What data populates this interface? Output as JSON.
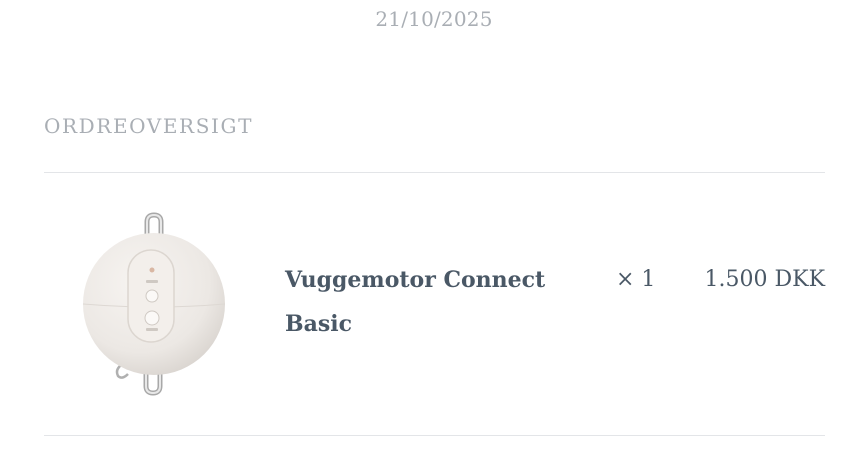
{
  "order": {
    "date": "21/10/2025",
    "section_title": "ORDREOVERSIGT"
  },
  "items": [
    {
      "name": "Vuggemotor Connect Basic",
      "quantity": "× 1",
      "price": "1.500 DKK",
      "image_icon": "cradle-motor-product-image"
    }
  ]
}
